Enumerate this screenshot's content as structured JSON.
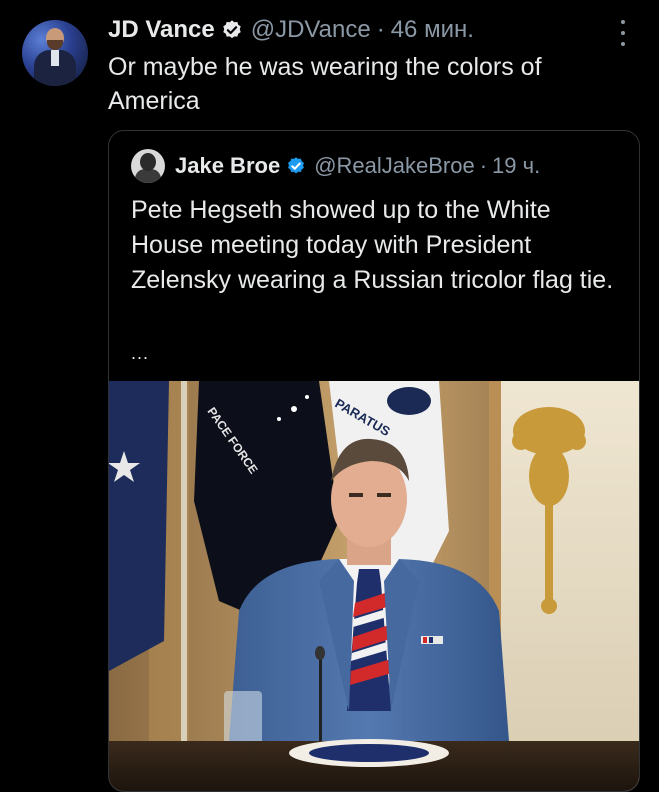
{
  "tweet": {
    "author_name": "JD Vance",
    "handle": "@JDVance",
    "separator": "·",
    "time": "46 мин.",
    "text": "Or maybe he was wearing the colors of America"
  },
  "quoted_tweet": {
    "author_name": "Jake Broe",
    "handle": "@RealJakeBroe",
    "separator": "·",
    "time": "19 ч.",
    "text": "Pete Hegseth showed up to the White House meeting today with President Zelensky wearing a Russian tricolor flag tie.",
    "ellipsis": "...",
    "media": {
      "flag_text_left": "PACE FORCE",
      "flag_text_right": "PARATUS"
    }
  },
  "icons": {
    "verified": "verified-badge-icon",
    "more": "more-options-icon"
  },
  "colors": {
    "background": "#000000",
    "text_primary": "#e7e9ea",
    "text_secondary": "#8b98a5",
    "verified_blue": "#1d9bf0",
    "border": "#2f3336"
  }
}
